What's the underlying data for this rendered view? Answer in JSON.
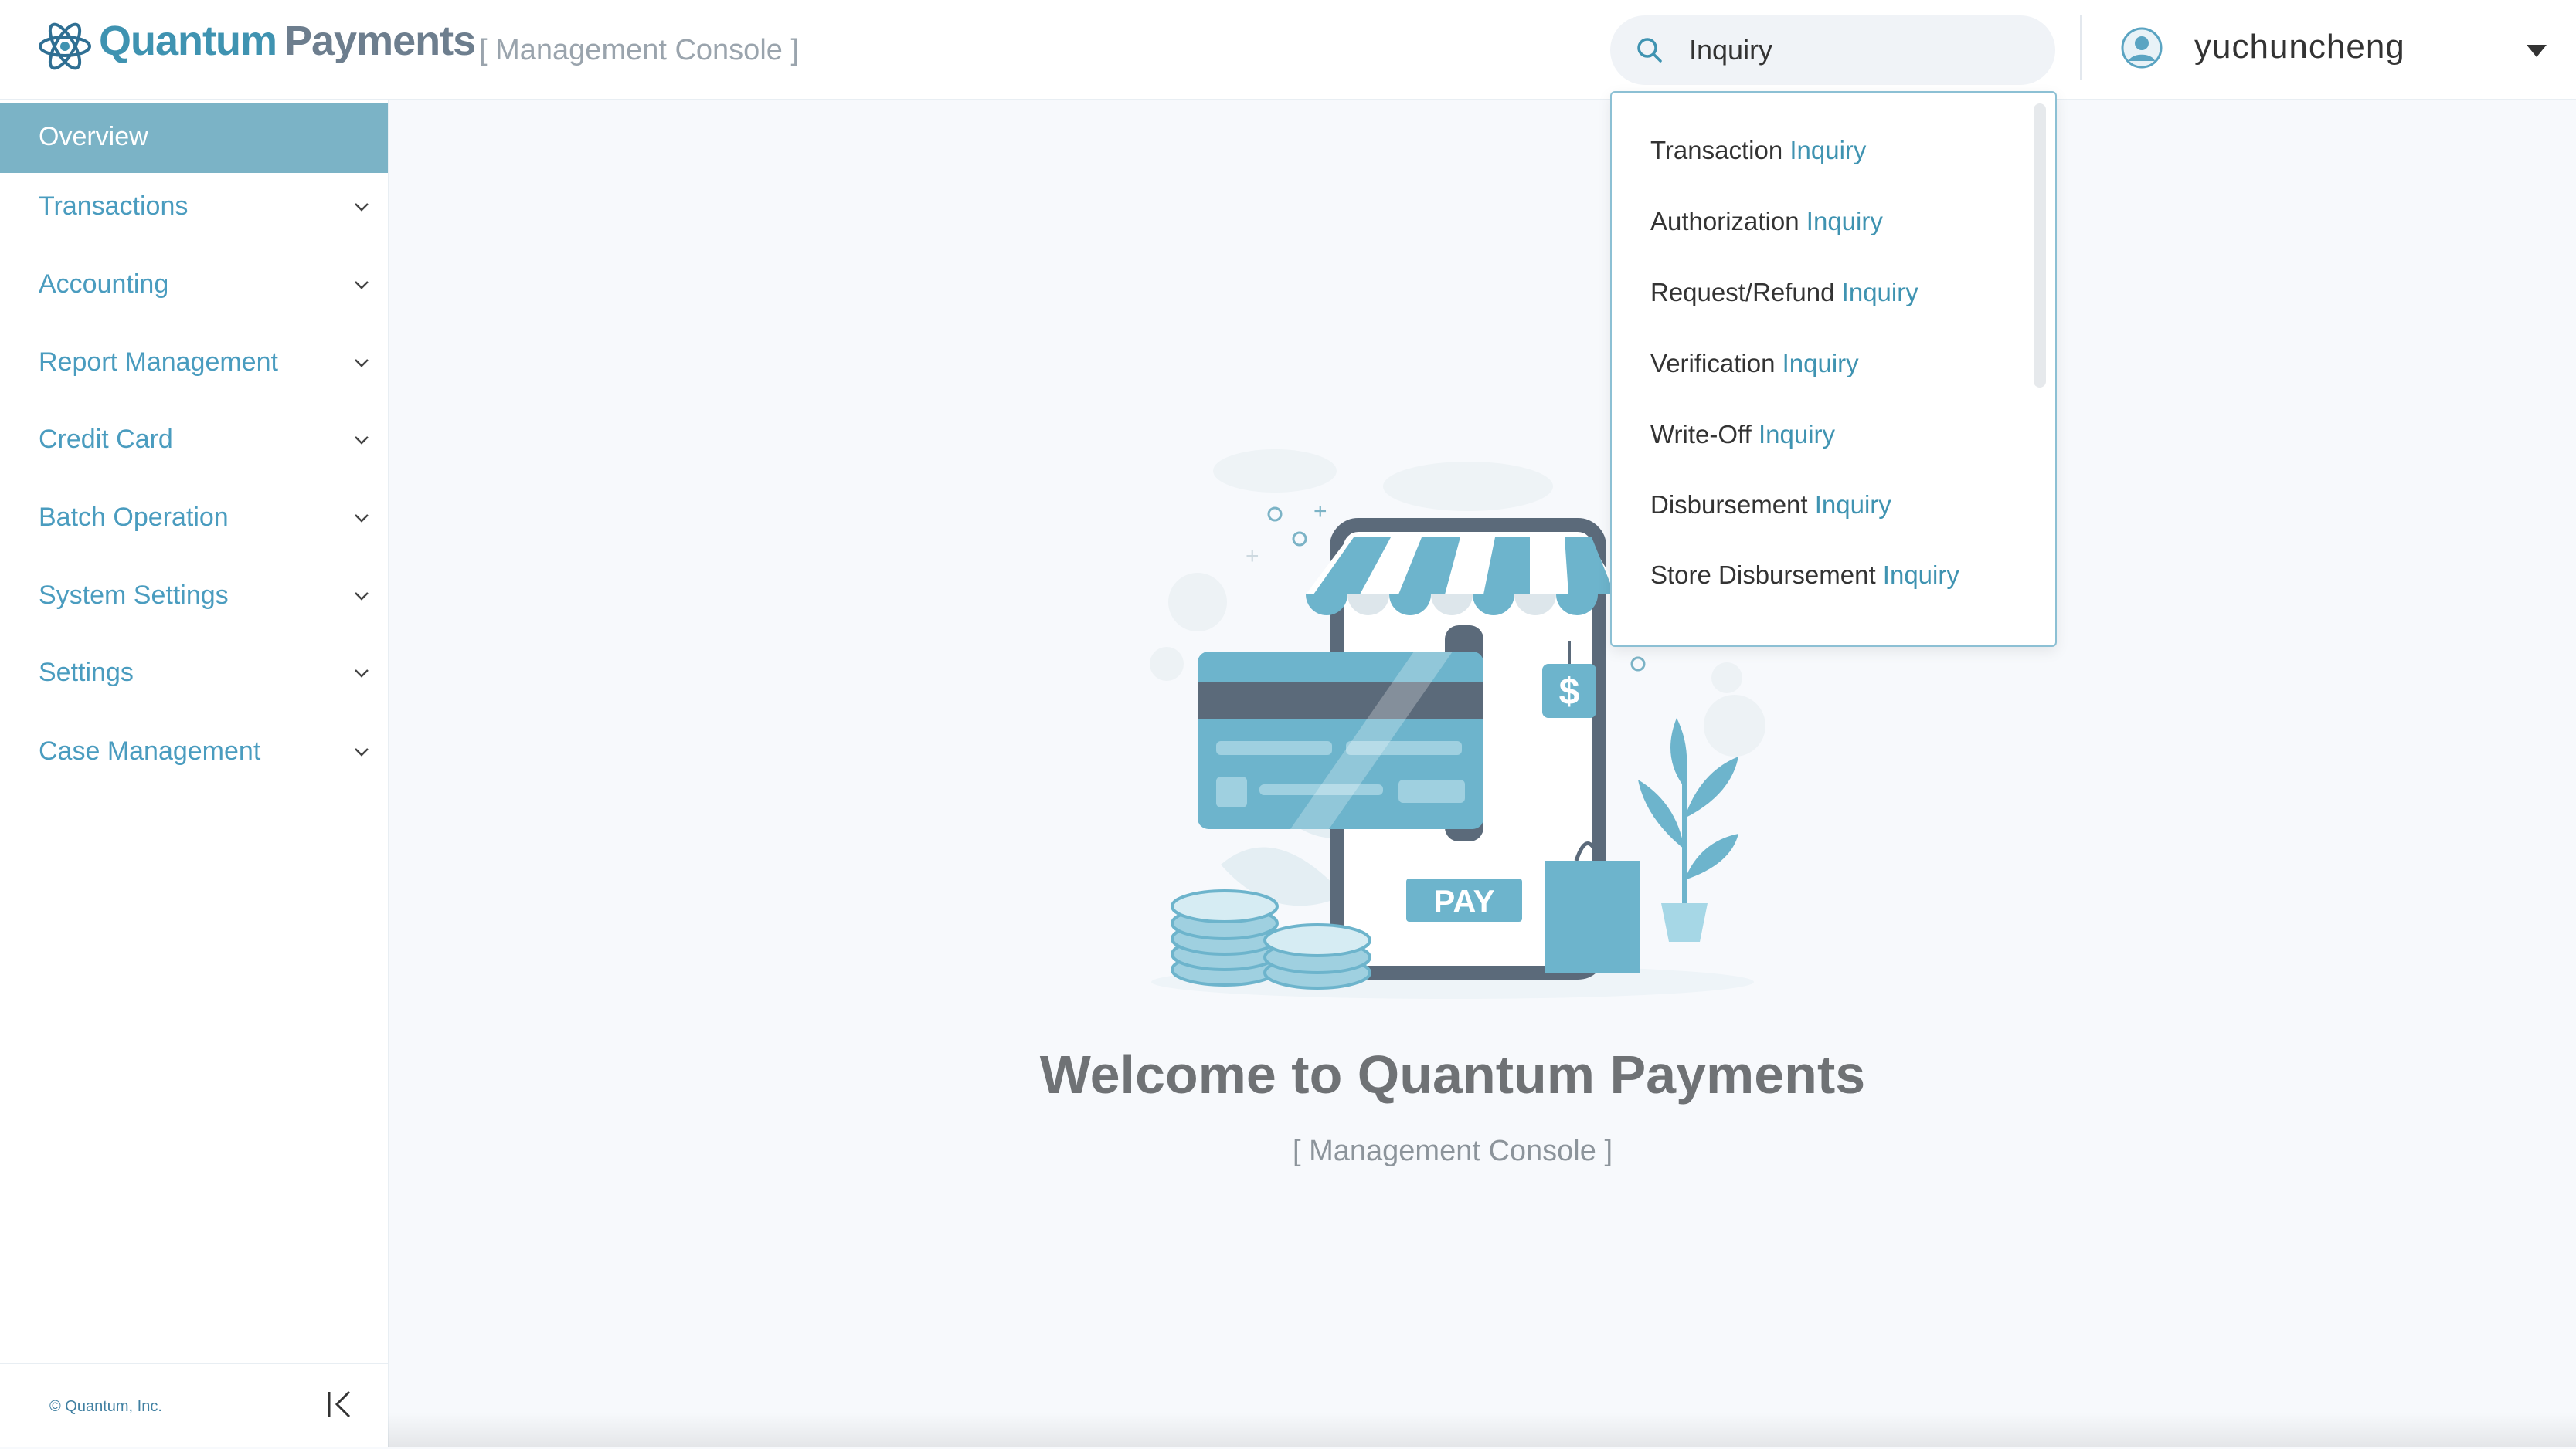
{
  "header": {
    "brand_primary": "Quantum",
    "brand_secondary": "Payments",
    "subtitle": "[ Management Console ]",
    "search": {
      "value": "Inquiry",
      "placeholder": ""
    },
    "user": {
      "name": "yuchuncheng"
    }
  },
  "sidebar": {
    "items": [
      {
        "label": "Overview",
        "active": true
      },
      {
        "label": "Transactions"
      },
      {
        "label": "Accounting"
      },
      {
        "label": "Report Management"
      },
      {
        "label": "Credit Card"
      },
      {
        "label": "Batch Operation"
      },
      {
        "label": "System Settings"
      },
      {
        "label": "Settings"
      },
      {
        "label": "Case Management"
      }
    ],
    "footer": {
      "copyright": "© Quantum, Inc."
    }
  },
  "search_results": [
    {
      "prefix": "Transaction",
      "match": "Inquiry"
    },
    {
      "prefix": "Authorization",
      "match": "Inquiry"
    },
    {
      "prefix": "Request/Refund",
      "match": "Inquiry"
    },
    {
      "prefix": "Verification",
      "match": "Inquiry"
    },
    {
      "prefix": "Write-Off",
      "match": "Inquiry"
    },
    {
      "prefix": "Disbursement",
      "match": "Inquiry"
    },
    {
      "prefix": "Store Disbursement",
      "match": "Inquiry"
    }
  ],
  "main": {
    "illustration_pay_label": "PAY",
    "illustration_currency": "$",
    "welcome_title": "Welcome to Quantum Payments",
    "welcome_subtitle": "[ Management Console ]"
  },
  "colors": {
    "accent": "#3f93b1",
    "sidebar_active_bg": "#7bb3c6",
    "nav_text": "#4a9cbf",
    "illustration_blue": "#6db4cc",
    "illustration_dark": "#5b6a7a"
  }
}
